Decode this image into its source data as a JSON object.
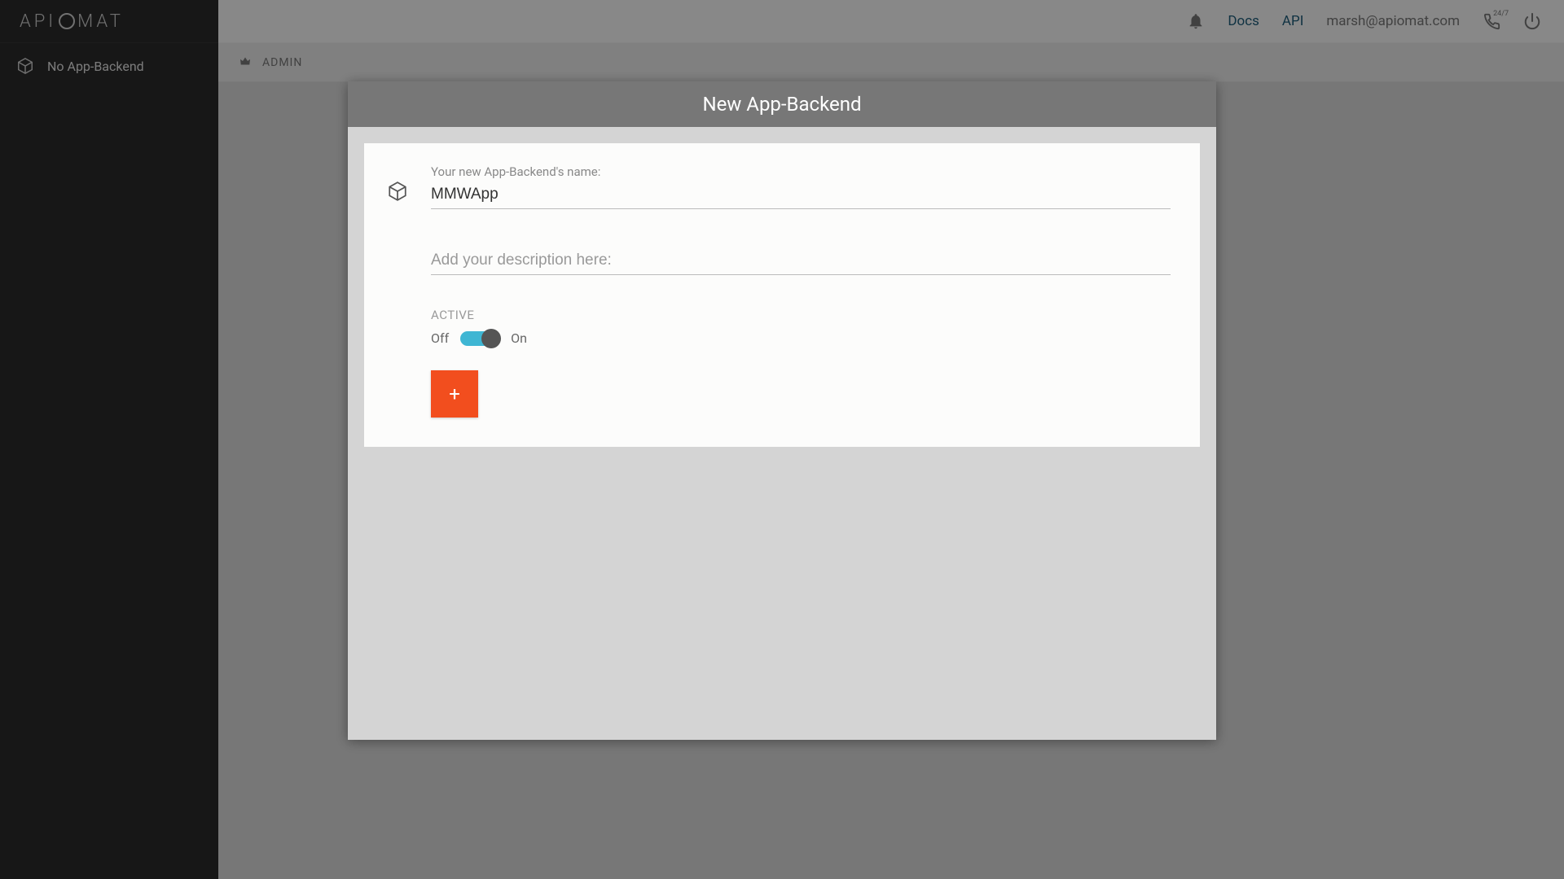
{
  "brand": {
    "prefix": "API",
    "suffix": "MAT"
  },
  "sidebar": {
    "item_label": "No App-Backend"
  },
  "topbar": {
    "docs": "Docs",
    "api": "API",
    "email": "marsh@apiomat.com",
    "support_badge": "24/7"
  },
  "admin_tab": "ADMIN",
  "modal": {
    "title": "New App-Backend",
    "name_label": "Your new App-Backend's name:",
    "name_value": "MMWApp",
    "desc_placeholder": "Add your description here:",
    "desc_value": "",
    "active_label": "ACTIVE",
    "toggle_off": "Off",
    "toggle_on": "On",
    "toggle_state": "on",
    "create_symbol": "+"
  }
}
